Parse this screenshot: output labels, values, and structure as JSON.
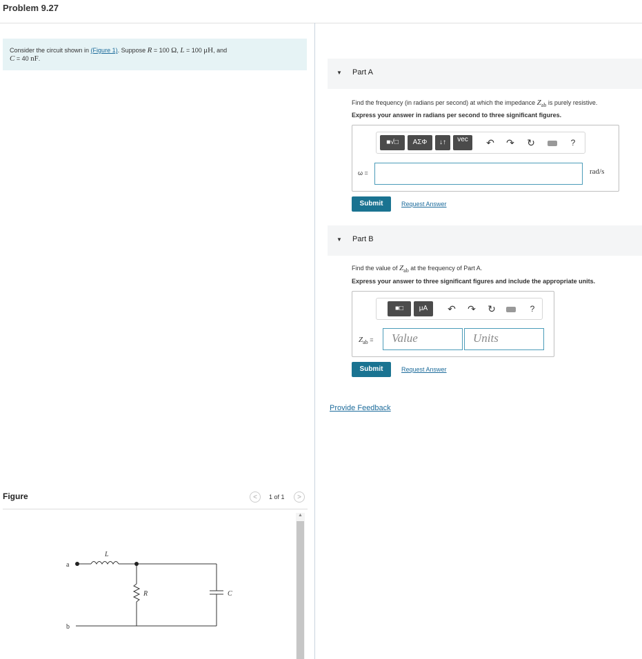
{
  "problem": {
    "title": "Problem 9.27"
  },
  "intro": {
    "text_before_link": "Consider the circuit shown in ",
    "figure_link": "(Figure 1)",
    "text_after_link": ". Suppose ",
    "r_symbol": "R",
    "r_eq": " = 100 ",
    "r_unit": "Ω",
    "comma1": ", ",
    "l_symbol": "L",
    "l_eq": " = 100 ",
    "l_unit": "μH",
    "and": ", and",
    "c_symbol": "C",
    "c_eq": " = 40 ",
    "c_unit": "nF",
    "period": "."
  },
  "figure": {
    "label": "Figure",
    "page_text": "1 of 1",
    "prev_glyph": "<",
    "next_glyph": ">",
    "node_a": "a",
    "node_b": "b",
    "label_L": "L",
    "label_R": "R",
    "label_C": "C"
  },
  "partA": {
    "arrow": "▼",
    "title": "Part A",
    "question_before": "Find the frequency (in radians per second) at which the impedance ",
    "question_symbol": "Z",
    "question_sub": "ab",
    "question_after": " is purely resistive.",
    "instruction": "Express your answer in radians per second to three significant figures.",
    "toolbar": {
      "templates": "■√□",
      "greek": "ΑΣΦ",
      "arrows": "↓↑",
      "vec": "vec",
      "undo": "↶",
      "redo": "↷",
      "reset": "↻",
      "help": "?"
    },
    "variable_label": "ω =",
    "input_value": "",
    "unit": "rad/s",
    "submit_label": "Submit",
    "request_label": "Request Answer"
  },
  "partB": {
    "arrow": "▼",
    "title": "Part B",
    "question_before": "Find the value of ",
    "question_symbol": "Z",
    "question_sub": "ab",
    "question_after": " at the frequency of Part A.",
    "instruction": "Express your answer to three significant figures and include the appropriate units.",
    "toolbar": {
      "templates": "■□",
      "units": "μA",
      "undo": "↶",
      "redo": "↷",
      "reset": "↻",
      "help": "?"
    },
    "variable_symbol": "Z",
    "variable_sub": "ab",
    "variable_eq": " =",
    "value_placeholder": "Value",
    "units_placeholder": "Units",
    "submit_label": "Submit",
    "request_label": "Request Answer"
  },
  "feedback": {
    "label": "Provide Feedback"
  },
  "colors": {
    "accent": "#1a7391",
    "link": "#1c6b9b",
    "intro_bg": "#e6f3f5",
    "input_border": "#4a9bb8"
  }
}
